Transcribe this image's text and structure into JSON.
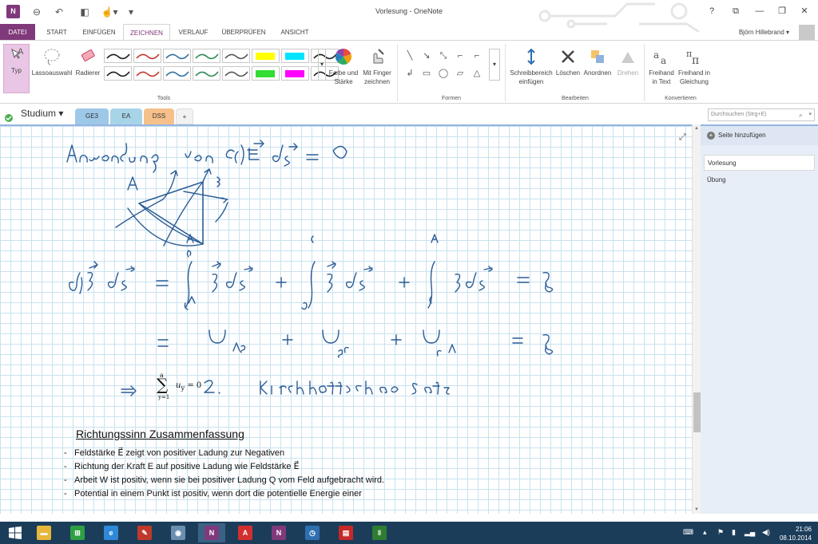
{
  "window": {
    "title": "Vorlesung - OneNote",
    "help": "?",
    "buttons": [
      "⧉",
      "—",
      "❐",
      "✕"
    ]
  },
  "quick_access": {
    "logo": "N"
  },
  "ribbon_tabs": [
    "DATEI",
    "START",
    "EINFÜGEN",
    "ZEICHNEN",
    "VERLAUF",
    "ÜBERPRÜFEN",
    "ANSICHT"
  ],
  "user": {
    "name": "Björn Hillebrand ▾"
  },
  "ribbon": {
    "type_label": "Typ",
    "lasso_label": "Lassoauswahl",
    "eraser_label": "Radierer",
    "color_label": "Farbe und Stärke",
    "finger_label": "Mit Finger zeichnen",
    "tools_group": "Tools",
    "shapes_group": "Formen",
    "insert_space_label": "Schreibbereich einfügen",
    "delete_label": "Löschen",
    "arrange_label": "Anordnen",
    "rotate_label": "Drehen",
    "edit_group": "Bearbeiten",
    "ink_text_label": "Freihand in Text",
    "ink_math_label": "Freihand in Gleichung",
    "convert_group": "Konvertieren",
    "pen_colors": [
      "#1a1a1a",
      "#c0392b",
      "#2f6f9f",
      "#2e8b57",
      "#555555",
      "#ffff00",
      "#00e5ff",
      "#1a1a1a",
      "#1a1a1a",
      "#c0392b",
      "#2f6f9f",
      "#2e8b57",
      "#555555",
      "#33dd33",
      "#ff00ff",
      "#1a1a1a"
    ]
  },
  "notebook": {
    "name": "Studium ▾",
    "sections": [
      {
        "label": "GE3",
        "color": "#9ec8e8"
      },
      {
        "label": "EA",
        "color": "#a8d4e8"
      },
      {
        "label": "DSS",
        "color": "#f6c08a"
      },
      {
        "label": "+",
        "color": "#f2f2f2"
      }
    ],
    "search_placeholder": "Durchsuchen (Strg+E)"
  },
  "pages": {
    "add_label": "Seite hinzufügen",
    "items": [
      "Vorlesung",
      "Übung"
    ]
  },
  "page": {
    "formula_html": "∑ u<sub>y</sub> = 0",
    "summary_title": "Richtungssinn Zusammenfassung",
    "bullets": [
      "Feldstärke E⃗ zeigt von positiver Ladung zur Negativen",
      "Richtung der Kraft E auf positive Ladung wie Feldstärke E⃗",
      "Arbeit W ist positiv, wenn sie bei positiver Ladung Q vom Feld aufgebracht wird.",
      "Potential in einem Punkt ist positiv, wenn dort die potentielle Energie einer"
    ]
  },
  "taskbar": {
    "apps": [
      {
        "name": "file-explorer",
        "color": "#e8b73a",
        "glyph": "▬"
      },
      {
        "name": "store",
        "color": "#2ea043",
        "glyph": "⊞"
      },
      {
        "name": "internet-explorer",
        "color": "#2f89d8",
        "glyph": "e"
      },
      {
        "name": "app-feather",
        "color": "#c0392b",
        "glyph": "✎"
      },
      {
        "name": "app-paint",
        "color": "#6a8fb0",
        "glyph": "◉"
      },
      {
        "name": "onenote",
        "color": "#80397b",
        "glyph": "N"
      },
      {
        "name": "acrobat",
        "color": "#d32f2f",
        "glyph": "A"
      },
      {
        "name": "onenote-tool",
        "color": "#80397b",
        "glyph": "N"
      },
      {
        "name": "clock-app",
        "color": "#2f6fb0",
        "glyph": "◷"
      },
      {
        "name": "news-app",
        "color": "#c62828",
        "glyph": "▤"
      },
      {
        "name": "food-app",
        "color": "#2e7d32",
        "glyph": "ǁ"
      }
    ],
    "time": "21:06",
    "date": "08.10.2014"
  }
}
